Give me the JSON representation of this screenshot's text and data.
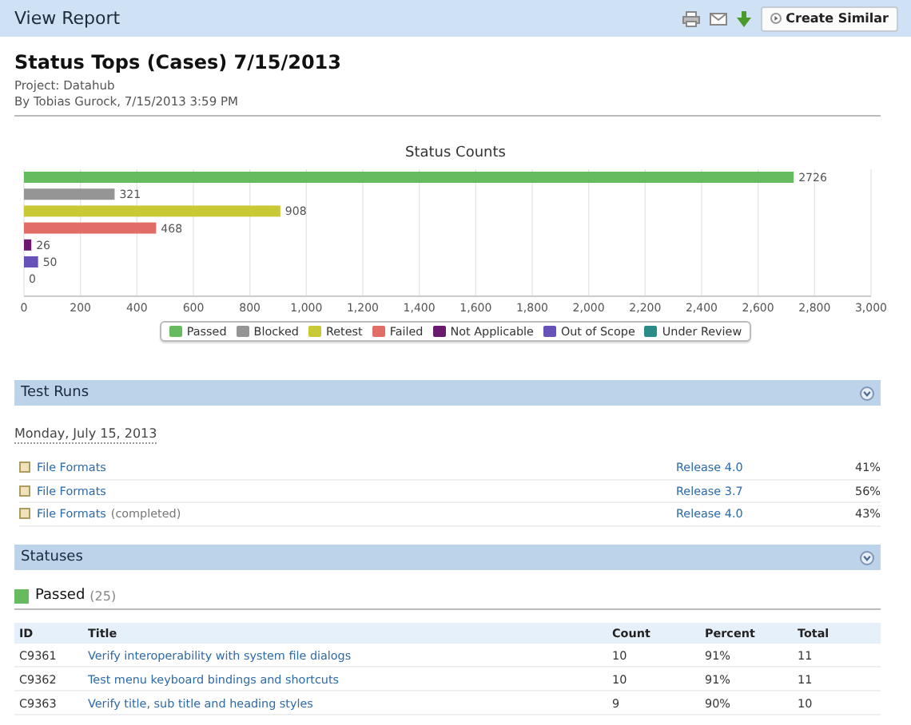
{
  "toolbar": {
    "title": "View Report",
    "button": "Create Similar"
  },
  "report": {
    "title": "Status Tops (Cases) 7/15/2013",
    "project": "Project: Datahub",
    "byline": "By Tobias Gurock, 7/15/2013 3:59 PM"
  },
  "chart": {
    "chart_data": {
      "type": "bar",
      "orientation": "horizontal",
      "title": "Status Counts",
      "series": [
        {
          "name": "Passed",
          "color": "#66bb5f",
          "values": [
            2726
          ]
        },
        {
          "name": "Blocked",
          "color": "#959595",
          "values": [
            321
          ]
        },
        {
          "name": "Retest",
          "color": "#c9c935",
          "values": [
            908
          ]
        },
        {
          "name": "Failed",
          "color": "#e06d66",
          "values": [
            468
          ]
        },
        {
          "name": "Not Applicable",
          "color": "#6a1a6e",
          "values": [
            26
          ]
        },
        {
          "name": "Out of Scope",
          "color": "#6652b8",
          "values": [
            50
          ]
        },
        {
          "name": "Under Review",
          "color": "#2b8b87",
          "values": [
            0
          ]
        }
      ],
      "grid": true,
      "xlim": [
        0,
        3000
      ],
      "xticks": [
        0,
        200,
        400,
        600,
        800,
        {
          "value": 1000,
          "label": "1,000"
        },
        {
          "value": 1200,
          "label": "1,200"
        },
        {
          "value": 1400,
          "label": "1,400"
        },
        {
          "value": 1600,
          "label": "1,600"
        },
        {
          "value": 1800,
          "label": "1,800"
        },
        {
          "value": 2000,
          "label": "2,000"
        },
        {
          "value": 2200,
          "label": "2,200"
        },
        {
          "value": 2400,
          "label": "2,400"
        },
        {
          "value": 2600,
          "label": "2,600"
        },
        {
          "value": 2800,
          "label": "2,800"
        },
        {
          "value": 3000,
          "label": "3,000"
        }
      ],
      "data_labels": true
    }
  },
  "test_runs": {
    "title": "Test Runs",
    "date": "Monday, July 15, 2013",
    "runs": [
      {
        "name": "File Formats",
        "milestone": "Release 4.0",
        "percent": "41%"
      },
      {
        "name": "File Formats",
        "milestone": "Release 3.7",
        "percent": "56%"
      },
      {
        "name": "File Formats",
        "note": "(completed)",
        "milestone": "Release 4.0",
        "percent": "43%"
      }
    ]
  },
  "statuses": {
    "title": "Statuses",
    "group": {
      "label": "Passed",
      "count": "(25)",
      "color": "#66bb5f"
    },
    "columns": [
      "ID",
      "Title",
      "Count",
      "Percent",
      "Total"
    ],
    "rows": [
      {
        "id": "C9361",
        "title": "Verify interoperability with system file dialogs",
        "count": "10",
        "percent": "91%",
        "total": "11"
      },
      {
        "id": "C9362",
        "title": "Test menu keyboard bindings and shortcuts",
        "count": "10",
        "percent": "91%",
        "total": "11"
      },
      {
        "id": "C9363",
        "title": "Verify title, sub title and heading styles",
        "count": "9",
        "percent": "90%",
        "total": "10"
      }
    ]
  }
}
